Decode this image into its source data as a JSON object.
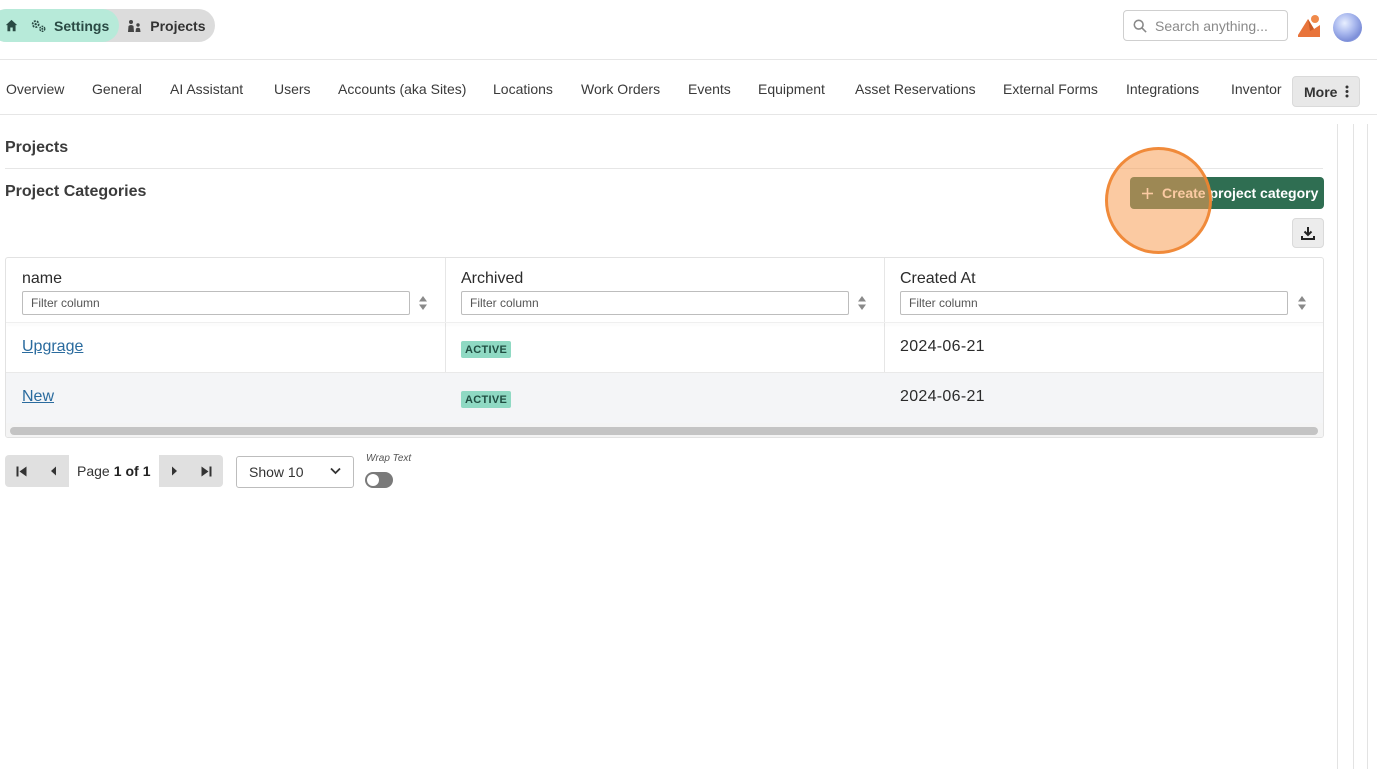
{
  "breadcrumb": {
    "home_icon": "home-icon",
    "settings": {
      "icon": "gears-icon",
      "label": "Settings"
    },
    "projects": {
      "icon": "people-icon",
      "label": "Projects"
    }
  },
  "search": {
    "icon": "search-icon",
    "placeholder": "Search anything..."
  },
  "header_icons": {
    "brand": "brand-logo-icon",
    "avatar": "user-avatar"
  },
  "tabs": {
    "items": [
      {
        "label": "Overview"
      },
      {
        "label": "General"
      },
      {
        "label": "AI Assistant"
      },
      {
        "label": "Users"
      },
      {
        "label": "Accounts (aka Sites)"
      },
      {
        "label": "Locations"
      },
      {
        "label": "Work Orders"
      },
      {
        "label": "Events"
      },
      {
        "label": "Equipment"
      },
      {
        "label": "Asset Reservations"
      },
      {
        "label": "External Forms"
      },
      {
        "label": "Integrations"
      },
      {
        "label": "Inventor"
      }
    ],
    "more_label": "More",
    "more_icon": "kebab-vertical-icon"
  },
  "page": {
    "section_title": "Projects",
    "subsection_title": "Project Categories",
    "create_button_label": "Create project category",
    "create_button_icon": "plus-icon",
    "download_icon": "download-icon"
  },
  "table": {
    "columns": [
      {
        "label": "name",
        "filter_placeholder": "Filter column"
      },
      {
        "label": "Archived",
        "filter_placeholder": "Filter column"
      },
      {
        "label": "Created At",
        "filter_placeholder": "Filter column"
      }
    ],
    "rows": [
      {
        "name": "Upgrage",
        "archived": "ACTIVE",
        "created_at": "2024-06-21"
      },
      {
        "name": "New",
        "archived": "ACTIVE",
        "created_at": "2024-06-21"
      }
    ]
  },
  "pagination": {
    "page_word": "Page",
    "current": "1",
    "of_word": "of",
    "total": "1",
    "show_select_value": "Show 10",
    "wrap_text_label": "Wrap Text",
    "wrap_text_on": false
  },
  "colors": {
    "primary_button": "#2f6e52",
    "badge_bg": "#8fd9c3",
    "breadcrumb_active": "#b7ead9",
    "click_marker": "#f79e55",
    "link": "#2a6b9e"
  }
}
